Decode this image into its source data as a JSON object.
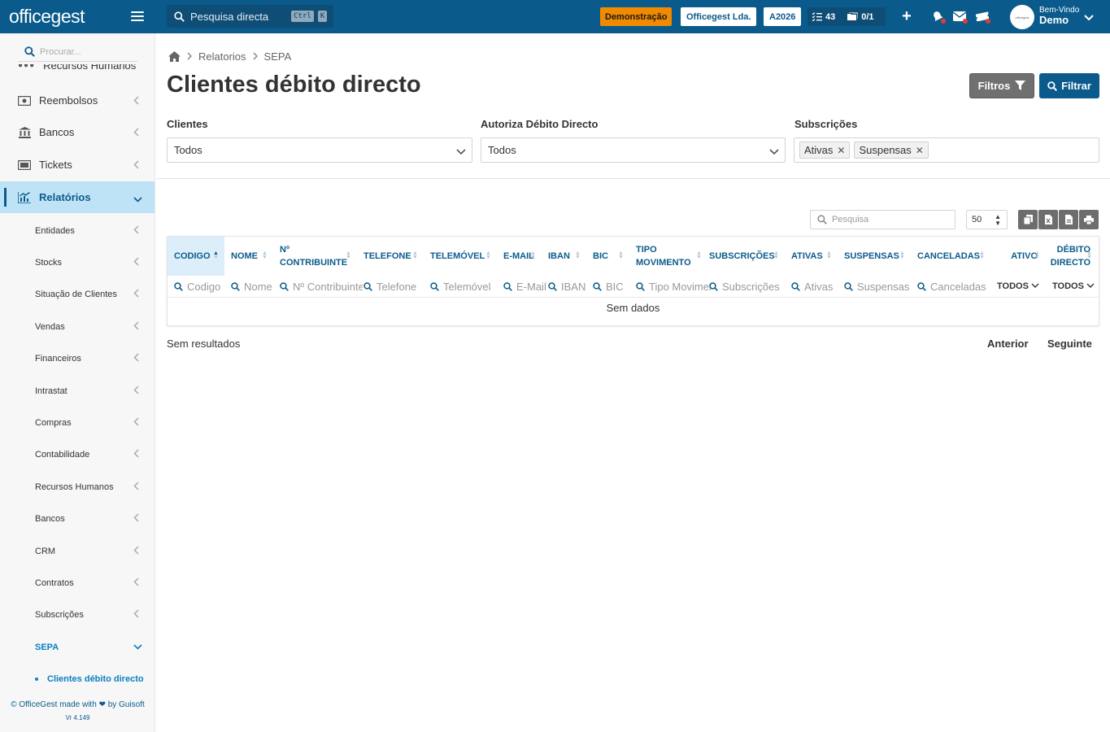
{
  "topbar": {
    "logo": "officegest",
    "search_placeholder": "Pesquisa directa",
    "shortcut_ctrl": "Ctrl",
    "shortcut_k": "K",
    "demo_label": "Demonstração",
    "company": "Officegest Lda.",
    "year": "A2026",
    "tasks_count": "43",
    "folders_count": "0/1",
    "user_greeting": "Bem-Vindo",
    "user_name": "Demo"
  },
  "sidebar": {
    "search_placeholder": "Procurar...",
    "clipped_item": "Recursos Humanos",
    "items": [
      {
        "label": "Reembolsos",
        "icon": "money-icon"
      },
      {
        "label": "Bancos",
        "icon": "bank-icon"
      },
      {
        "label": "Tickets",
        "icon": "ticket-icon"
      },
      {
        "label": "Relatórios",
        "icon": "chart-icon"
      }
    ],
    "submenu": [
      "Entidades",
      "Stocks",
      "Situação de Clientes",
      "Vendas",
      "Financeiros",
      "Intrastat",
      "Compras",
      "Contabilidade",
      "Recursos Humanos",
      "Bancos",
      "CRM",
      "Contratos",
      "Subscrições",
      "SEPA"
    ],
    "active_leaf": "Clientes débito directo",
    "footer_text": "© OfficeGest made with",
    "footer_by": "by Guisoft",
    "version": "Vr 4.149"
  },
  "breadcrumb": {
    "home_icon": "home-icon",
    "items": [
      "Relatorios",
      "SEPA"
    ]
  },
  "page": {
    "title": "Clientes débito directo",
    "filtros_label": "Filtros",
    "filtrar_label": "Filtrar"
  },
  "filters": {
    "clientes": {
      "label": "Clientes",
      "value": "Todos"
    },
    "autoriza": {
      "label": "Autoriza Débito Directo",
      "value": "Todos"
    },
    "subscricoes": {
      "label": "Subscrições",
      "chips": [
        "Ativas",
        "Suspensas"
      ]
    }
  },
  "table": {
    "search_placeholder": "Pesquisa",
    "page_size": "50",
    "columns": [
      {
        "label": "CODIGO",
        "filter": "Codigo"
      },
      {
        "label": "NOME",
        "filter": "Nome"
      },
      {
        "label": "Nº CONTRIBUINTE",
        "filter": "Nº Contribuinte"
      },
      {
        "label": "TELEFONE",
        "filter": "Telefone"
      },
      {
        "label": "TELEMÓVEL",
        "filter": "Telemóvel"
      },
      {
        "label": "E-MAIL",
        "filter": "E-Mail"
      },
      {
        "label": "IBAN",
        "filter": "IBAN"
      },
      {
        "label": "BIC",
        "filter": "BIC"
      },
      {
        "label": "TIPO MOVIMENTO",
        "filter": "Tipo Movimento"
      },
      {
        "label": "SUBSCRIÇÕES",
        "filter": "Subscrições"
      },
      {
        "label": "ATIVAS",
        "filter": "Ativas"
      },
      {
        "label": "SUSPENSAS",
        "filter": "Suspensas"
      },
      {
        "label": "CANCELADAS",
        "filter": "Canceladas"
      },
      {
        "label": "ATIVO",
        "filter": "TODOS"
      },
      {
        "label": "DÉBITO DIRECTO",
        "filter": "TODOS"
      }
    ],
    "empty_text": "Sem dados",
    "results_text": "Sem resultados",
    "prev_label": "Anterior",
    "next_label": "Seguinte"
  },
  "colors": {
    "primary": "#0a5b8c",
    "accent_orange": "#f08a00",
    "active_bg": "#bfe3f6"
  }
}
